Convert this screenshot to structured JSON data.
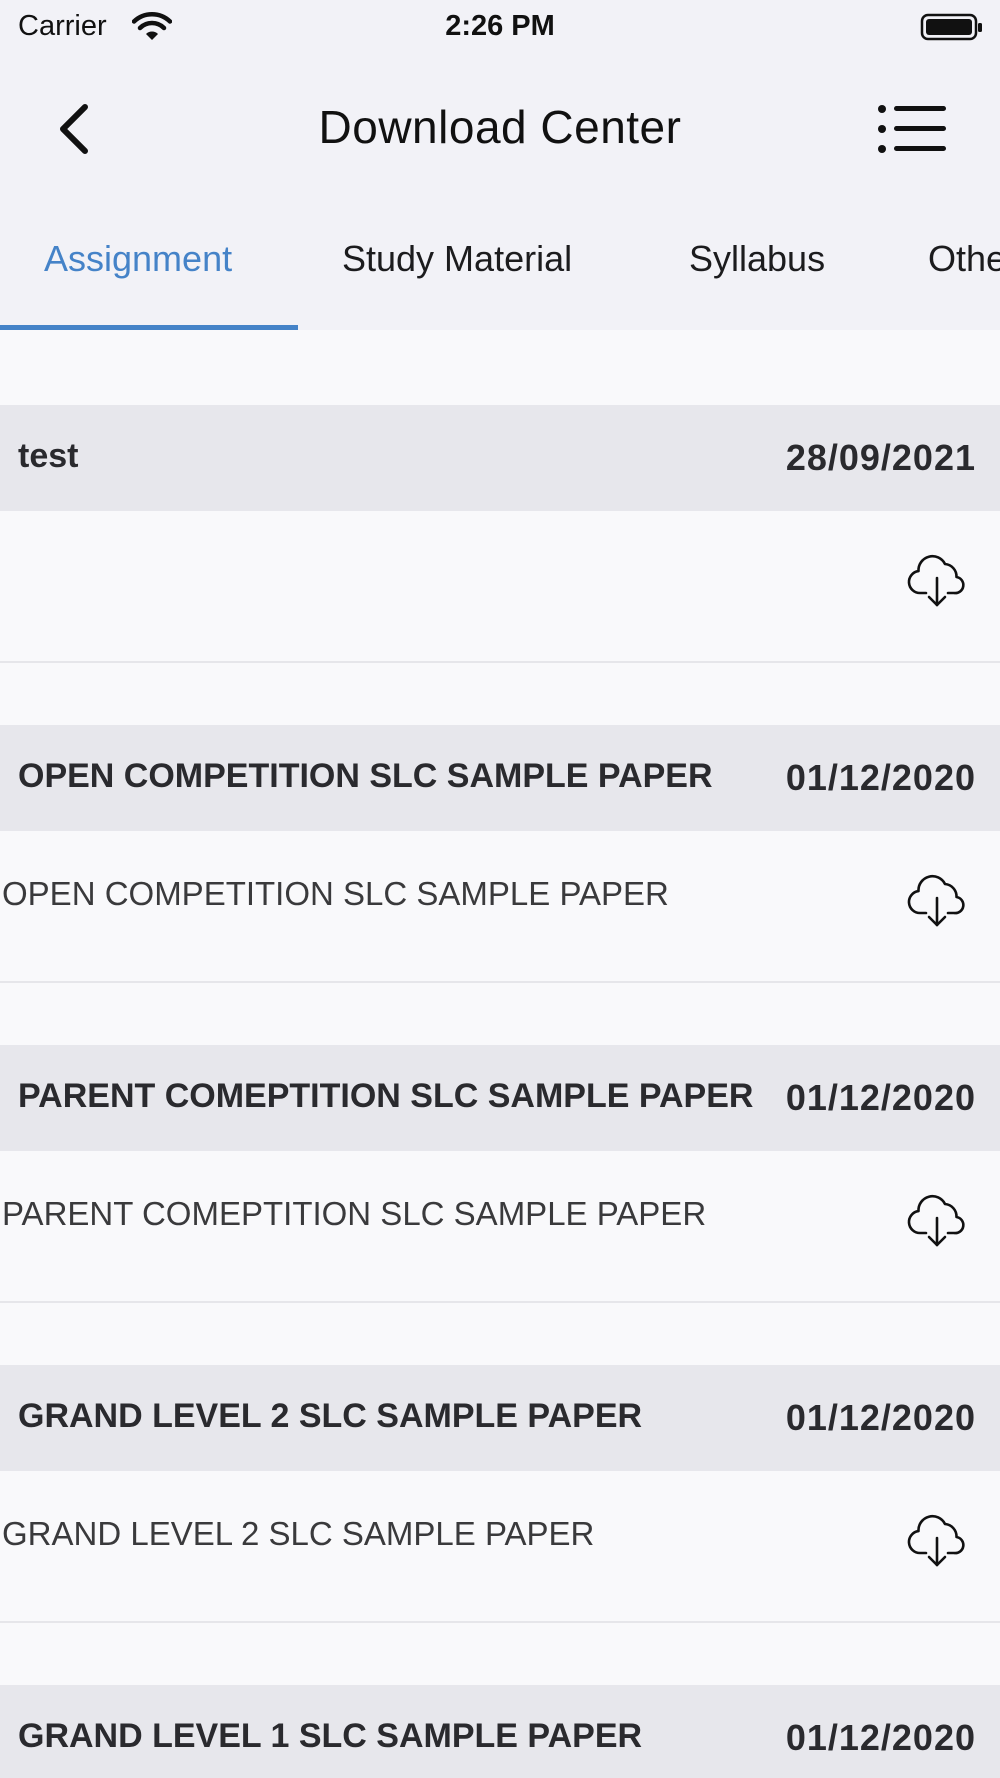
{
  "status_bar": {
    "carrier": "Carrier",
    "time": "2:26 PM"
  },
  "nav": {
    "title": "Download Center",
    "back_icon": "chevron-left-icon",
    "menu_icon": "list-menu-icon"
  },
  "tabs": [
    {
      "label": "Assignment",
      "active": true
    },
    {
      "label": "Study Material",
      "active": false
    },
    {
      "label": "Syllabus",
      "active": false
    },
    {
      "label": "Othe",
      "active": false
    }
  ],
  "colors": {
    "accent": "#4583c8",
    "header_bg": "#e7e7ec",
    "page_bg": "#f9f9fb"
  },
  "entries": [
    {
      "title": "test",
      "date": "28/09/2021",
      "description": "",
      "icon": "cloud-download-icon"
    },
    {
      "title": "OPEN COMPETITION SLC SAMPLE PAPER",
      "date": "01/12/2020",
      "description": "OPEN COMPETITION SLC SAMPLE PAPER",
      "icon": "cloud-download-icon"
    },
    {
      "title": "PARENT COMEPTITION SLC SAMPLE PAPER",
      "date": "01/12/2020",
      "description": "PARENT COMEPTITION SLC SAMPLE PAPER",
      "icon": "cloud-download-icon"
    },
    {
      "title": "GRAND LEVEL 2 SLC SAMPLE PAPER",
      "date": "01/12/2020",
      "description": "GRAND LEVEL 2 SLC SAMPLE PAPER",
      "icon": "cloud-download-icon"
    },
    {
      "title": "GRAND LEVEL 1 SLC SAMPLE PAPER",
      "date": "01/12/2020",
      "description": "",
      "icon": "cloud-download-icon"
    }
  ]
}
